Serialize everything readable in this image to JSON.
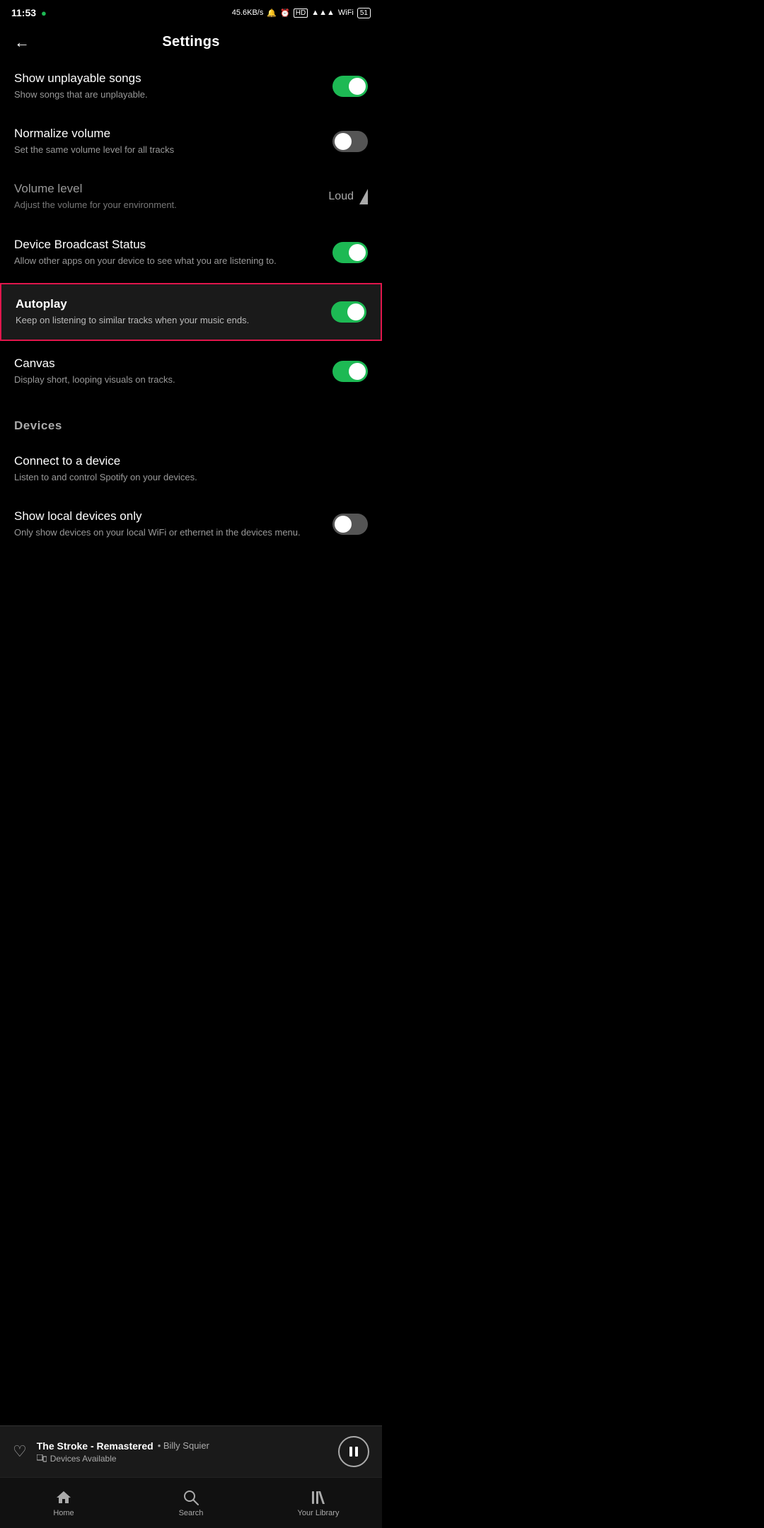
{
  "statusBar": {
    "time": "11:53",
    "network": "45.6KB/s",
    "battery": "51"
  },
  "header": {
    "title": "Settings",
    "backLabel": "←"
  },
  "settings": [
    {
      "id": "show-unplayable",
      "title": "Show unplayable songs",
      "desc": "Show songs that are unplayable.",
      "type": "toggle",
      "toggleState": "on",
      "highlighted": false
    },
    {
      "id": "normalize-volume",
      "title": "Normalize volume",
      "desc": "Set the same volume level for all tracks",
      "type": "toggle",
      "toggleState": "off",
      "highlighted": false
    },
    {
      "id": "volume-level",
      "title": "Volume level",
      "desc": "Adjust the volume for your environment.",
      "type": "value",
      "value": "Loud",
      "highlighted": false
    },
    {
      "id": "device-broadcast",
      "title": "Device Broadcast Status",
      "desc": "Allow other apps on your device to see what you are listening to.",
      "type": "toggle",
      "toggleState": "on",
      "highlighted": false
    },
    {
      "id": "autoplay",
      "title": "Autoplay",
      "desc": "Keep on listening to similar tracks when your music ends.",
      "type": "toggle",
      "toggleState": "on",
      "highlighted": true
    },
    {
      "id": "canvas",
      "title": "Canvas",
      "desc": "Display short, looping visuals on tracks.",
      "type": "toggle",
      "toggleState": "on",
      "highlighted": false
    }
  ],
  "devicesSection": {
    "label": "Devices",
    "items": [
      {
        "id": "connect-device",
        "title": "Connect to a device",
        "desc": "Listen to and control Spotify on your devices.",
        "type": "none"
      },
      {
        "id": "local-devices",
        "title": "Show local devices only",
        "desc": "Only show devices on your local WiFi or ethernet in the devices menu.",
        "type": "toggle",
        "toggleState": "off"
      }
    ]
  },
  "nowPlaying": {
    "trackName": "The Stroke - Remastered",
    "artist": "Billy Squier",
    "devicesLabel": "Devices Available",
    "isPlaying": true
  },
  "bottomNav": [
    {
      "id": "home",
      "label": "Home",
      "icon": "⌂",
      "active": false
    },
    {
      "id": "search",
      "label": "Search",
      "icon": "🔍",
      "active": false
    },
    {
      "id": "library",
      "label": "Your Library",
      "icon": "|||",
      "active": false
    }
  ]
}
